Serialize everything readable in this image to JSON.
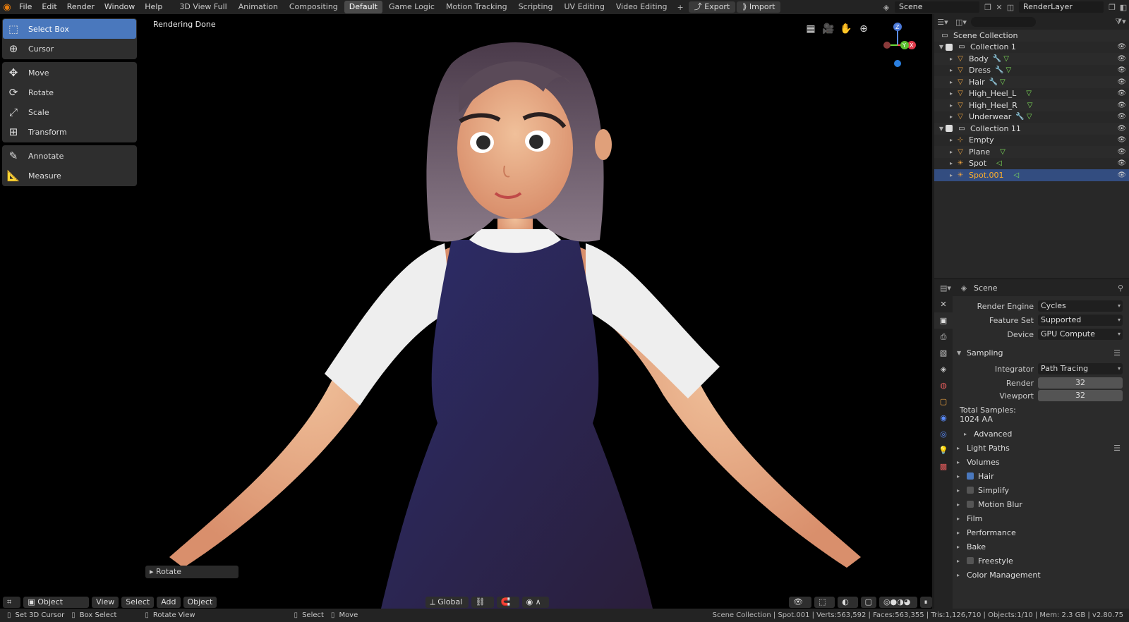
{
  "menu": [
    "File",
    "Edit",
    "Render",
    "Window",
    "Help"
  ],
  "workspaces": [
    {
      "label": "3D View Full",
      "active": false
    },
    {
      "label": "Animation",
      "active": false
    },
    {
      "label": "Compositing",
      "active": false
    },
    {
      "label": "Default",
      "active": true
    },
    {
      "label": "Game Logic",
      "active": false
    },
    {
      "label": "Motion Tracking",
      "active": false
    },
    {
      "label": "Scripting",
      "active": false
    },
    {
      "label": "UV Editing",
      "active": false
    },
    {
      "label": "Video Editing",
      "active": false
    }
  ],
  "top_buttons": {
    "export": "Export",
    "import": "Import"
  },
  "scene_name": "Scene",
  "view_layer": "RenderLayer",
  "viewport": {
    "status": "Rendering Done"
  },
  "tools": [
    [
      {
        "label": "Select Box",
        "icon": "select-box-icon",
        "glyph": "⬚",
        "active": true
      },
      {
        "label": "Cursor",
        "icon": "cursor-icon",
        "glyph": "⊕",
        "active": false
      }
    ],
    [
      {
        "label": "Move",
        "icon": "move-icon",
        "glyph": "✥",
        "active": false
      },
      {
        "label": "Rotate",
        "icon": "rotate-icon",
        "glyph": "⟳",
        "active": false
      },
      {
        "label": "Scale",
        "icon": "scale-icon",
        "glyph": "⤢",
        "active": false
      },
      {
        "label": "Transform",
        "icon": "transform-icon",
        "glyph": "⊞",
        "active": false
      }
    ],
    [
      {
        "label": "Annotate",
        "icon": "annotate-icon",
        "glyph": "✎",
        "active": false
      },
      {
        "label": "Measure",
        "icon": "measure-icon",
        "glyph": "📐",
        "active": false
      }
    ]
  ],
  "gizmo": {
    "z": "Z",
    "y": "Y",
    "x": "X"
  },
  "last_op": "Rotate",
  "header": {
    "mode": "Object Mode",
    "view": "View",
    "select": "Select",
    "add": "Add",
    "object": "Object",
    "orientation": "Global"
  },
  "outliner": {
    "search_placeholder": "",
    "root": "Scene Collection",
    "rows": [
      {
        "label": "Collection 1",
        "type": "collection",
        "indent": 1,
        "mod": false,
        "data": "",
        "expanded": true
      },
      {
        "label": "Body",
        "type": "mesh",
        "indent": 2,
        "mod": true,
        "data": "mesh"
      },
      {
        "label": "Dress",
        "type": "mesh",
        "indent": 2,
        "mod": true,
        "data": "mesh"
      },
      {
        "label": "Hair",
        "type": "mesh",
        "indent": 2,
        "mod": true,
        "data": "mesh"
      },
      {
        "label": "High_Heel_L",
        "type": "mesh",
        "indent": 2,
        "mod": false,
        "data": "mesh"
      },
      {
        "label": "High_Heel_R",
        "type": "mesh",
        "indent": 2,
        "mod": false,
        "data": "mesh"
      },
      {
        "label": "Underwear",
        "type": "mesh",
        "indent": 2,
        "mod": true,
        "data": "mesh"
      },
      {
        "label": "Collection 11",
        "type": "collection",
        "indent": 1,
        "mod": false,
        "data": "",
        "expanded": true
      },
      {
        "label": "Empty",
        "type": "empty",
        "indent": 2,
        "mod": false,
        "data": ""
      },
      {
        "label": "Plane",
        "type": "mesh",
        "indent": 2,
        "mod": false,
        "data": "mesh"
      },
      {
        "label": "Spot",
        "type": "light",
        "indent": 2,
        "mod": false,
        "data": "light"
      },
      {
        "label": "Spot.001",
        "type": "light",
        "indent": 2,
        "mod": false,
        "data": "light",
        "selected": true
      }
    ]
  },
  "properties": {
    "context": "Scene",
    "render_engine": {
      "label": "Render Engine",
      "value": "Cycles"
    },
    "feature_set": {
      "label": "Feature Set",
      "value": "Supported"
    },
    "device": {
      "label": "Device",
      "value": "GPU Compute"
    },
    "sampling": {
      "title": "Sampling",
      "integrator_label": "Integrator",
      "integrator": "Path Tracing",
      "render_label": "Render",
      "render": "32",
      "viewport_label": "Viewport",
      "viewport": "32",
      "total_label": "Total Samples:",
      "total": "1024 AA",
      "advanced": "Advanced"
    },
    "sections": [
      {
        "label": "Light Paths",
        "checkbox": null,
        "list": true
      },
      {
        "label": "Volumes",
        "checkbox": null,
        "list": false
      },
      {
        "label": "Hair",
        "checkbox": true,
        "list": false
      },
      {
        "label": "Simplify",
        "checkbox": false,
        "list": false
      },
      {
        "label": "Motion Blur",
        "checkbox": false,
        "list": false
      },
      {
        "label": "Film",
        "checkbox": null,
        "list": false
      },
      {
        "label": "Performance",
        "checkbox": null,
        "list": false
      },
      {
        "label": "Bake",
        "checkbox": null,
        "list": false
      },
      {
        "label": "Freestyle",
        "checkbox": false,
        "list": false
      },
      {
        "label": "Color Management",
        "checkbox": null,
        "list": false
      }
    ]
  },
  "statusbar": {
    "hint1": "Set 3D Cursor",
    "hint2": "Box Select",
    "hint3": "Rotate View",
    "hint4": "Select",
    "hint5": "Move",
    "stats": "Scene Collection | Spot.001 | Verts:563,592 | Faces:563,355 | Tris:1,126,710 | Objects:1/10 | Mem: 2.3 GB | v2.80.75"
  },
  "colors": {
    "accent": "#4a78bd",
    "selected_text": "#ffaf29",
    "blender_orange": "#e87d0d"
  }
}
